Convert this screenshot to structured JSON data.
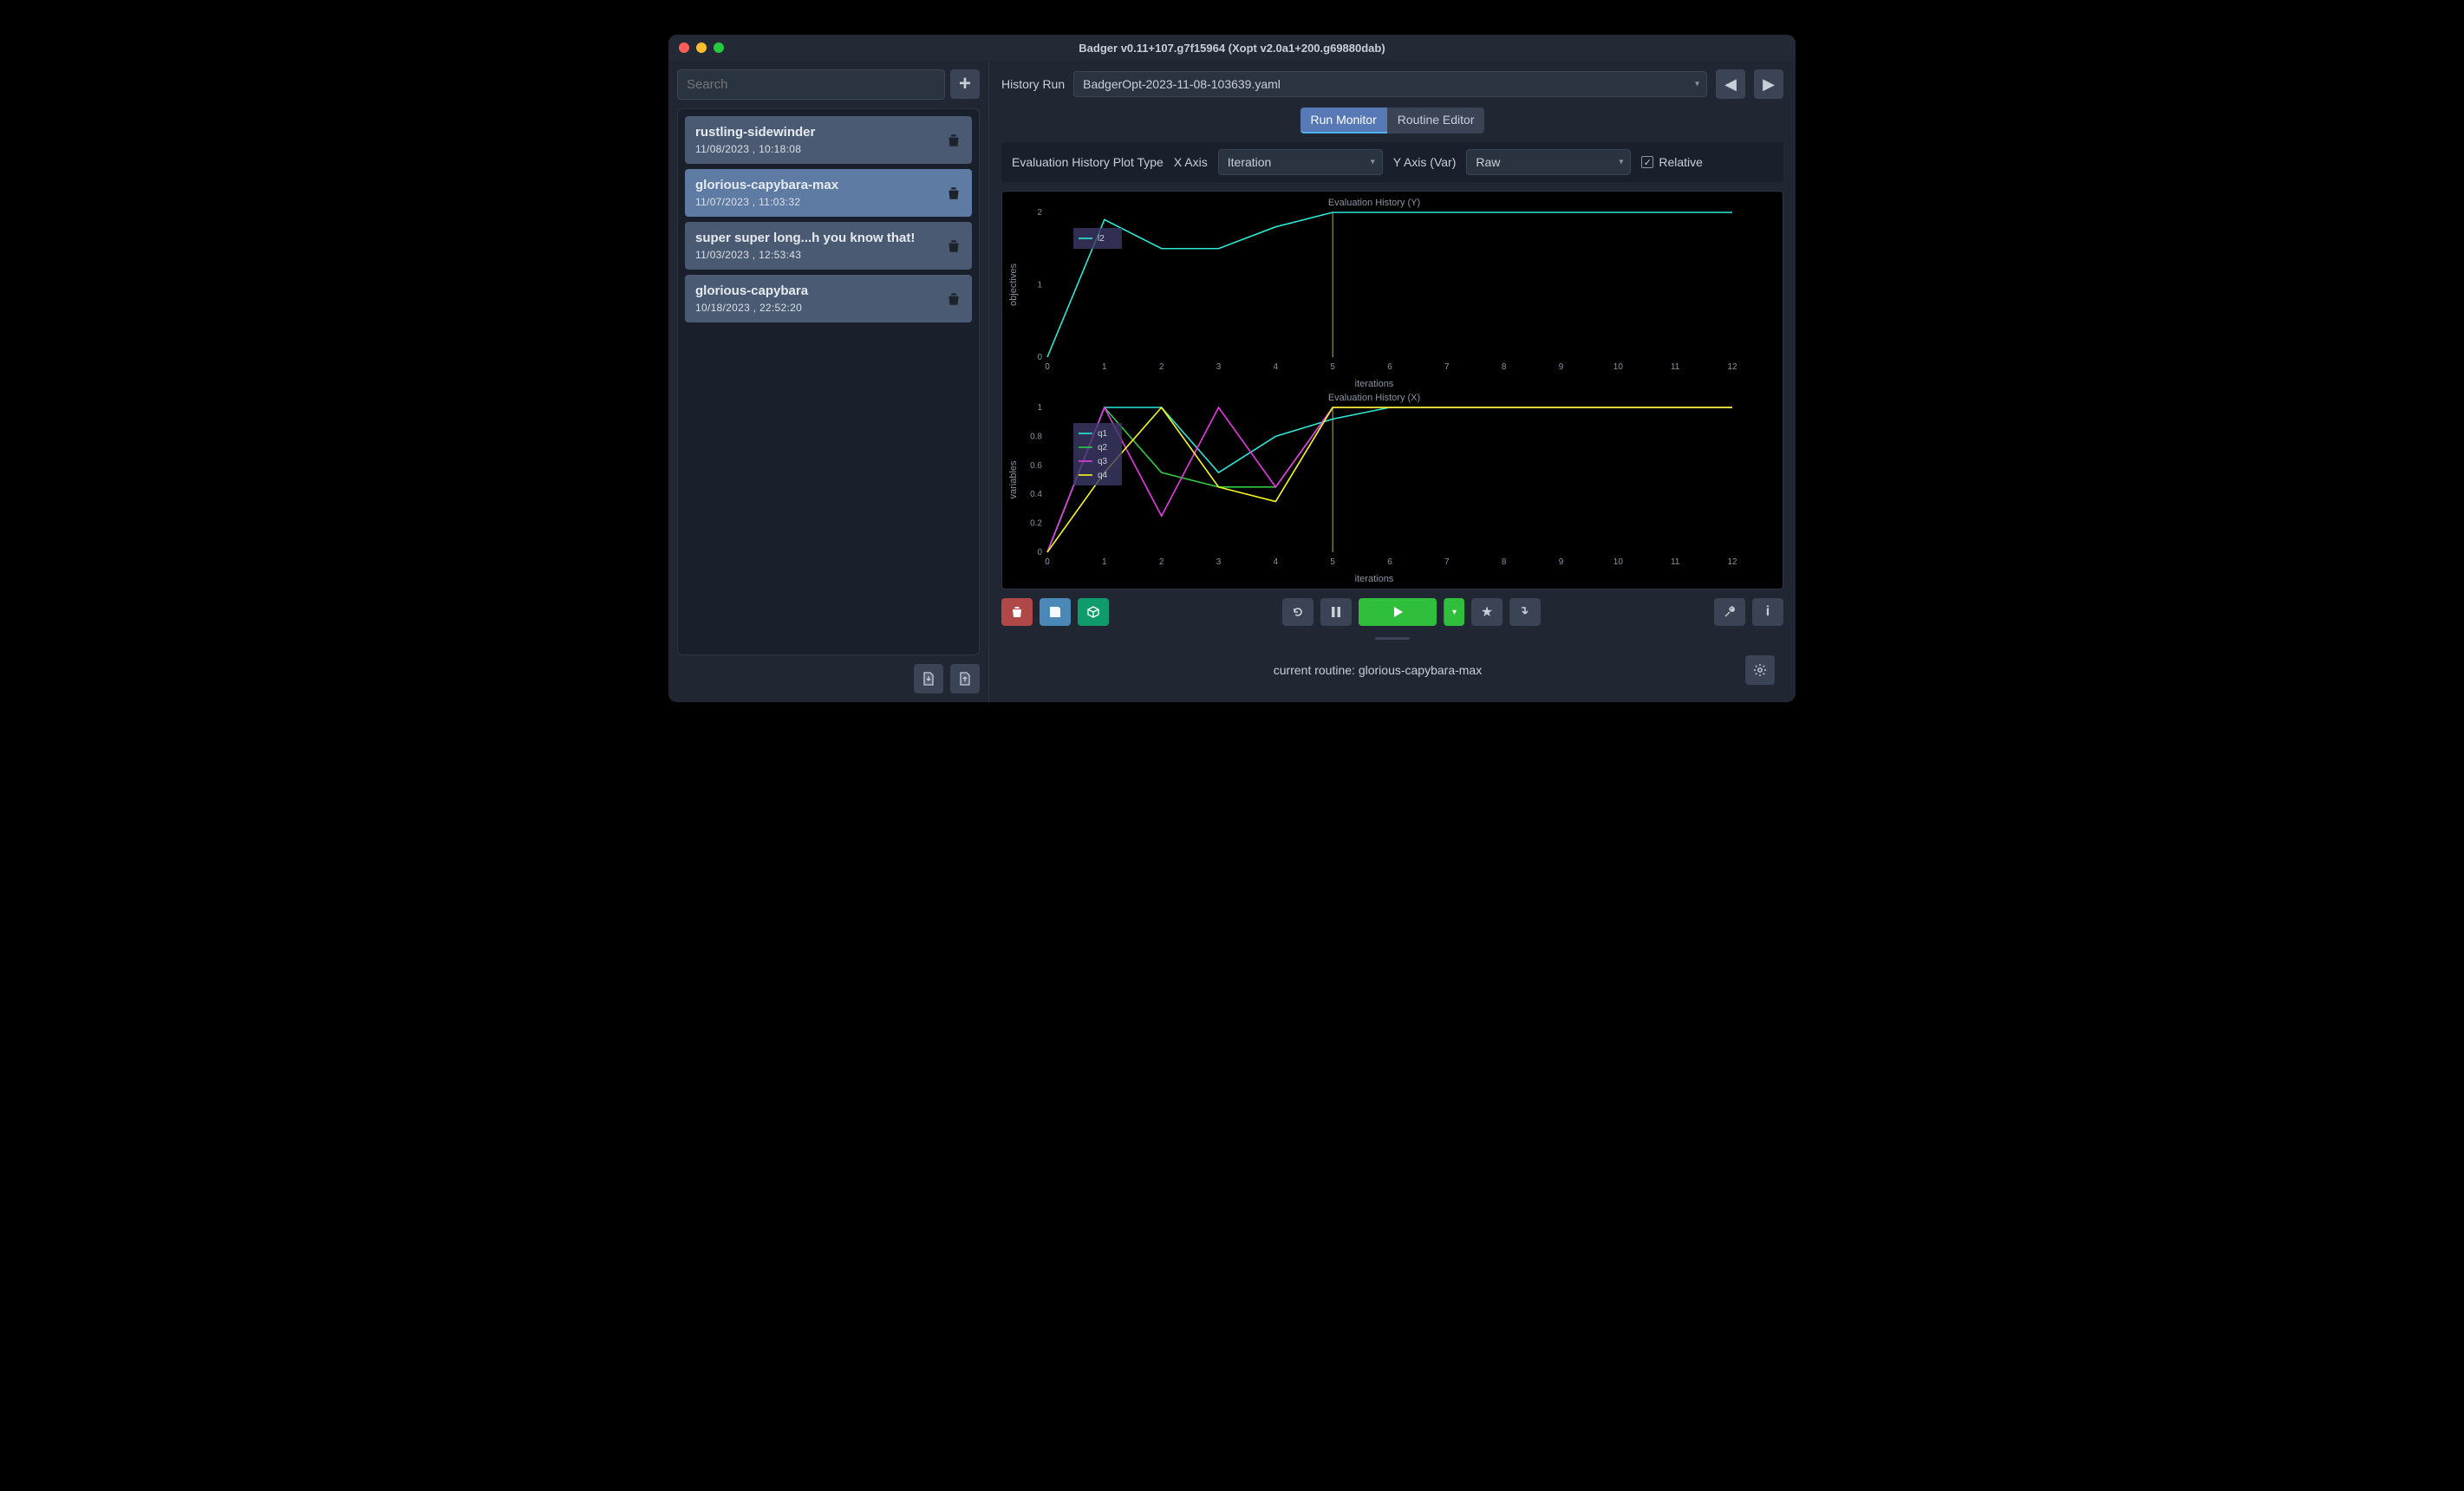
{
  "window_title": "Badger v0.11+107.g7f15964 (Xopt v2.0a1+200.g69880dab)",
  "search": {
    "placeholder": "Search"
  },
  "routines": [
    {
      "name": "rustling-sidewinder",
      "ts": "11/08/2023 , 10:18:08",
      "active": false
    },
    {
      "name": "glorious-capybara-max",
      "ts": "11/07/2023 , 11:03:32",
      "active": true
    },
    {
      "name": "super super long...h you know that!",
      "ts": "11/03/2023 , 12:53:43",
      "active": false
    },
    {
      "name": "glorious-capybara",
      "ts": "10/18/2023 , 22:52:20",
      "active": false
    }
  ],
  "history_run": {
    "label": "History Run",
    "value": "BadgerOpt-2023-11-08-103639.yaml"
  },
  "tabs": {
    "monitor": "Run Monitor",
    "editor": "Routine Editor",
    "active": "monitor"
  },
  "plot_controls": {
    "type_label": "Evaluation History Plot Type",
    "xaxis_label": "X Axis",
    "xaxis_value": "Iteration",
    "yaxis_label": "Y Axis (Var)",
    "yaxis_value": "Raw",
    "relative_label": "Relative",
    "relative_checked": true
  },
  "status": {
    "current_routine_label": "current routine: ",
    "current_routine_value": "glorious-capybara-max"
  },
  "chart_data": [
    {
      "type": "line",
      "title": "Evaluation History (Y)",
      "xlabel": "iterations",
      "ylabel": "objectives",
      "x_ticks": [
        0,
        1,
        2,
        3,
        4,
        5,
        6,
        7,
        8,
        9,
        10,
        11,
        12
      ],
      "y_ticks": [
        0,
        1,
        2
      ],
      "xlim": [
        0,
        12
      ],
      "ylim": [
        0,
        2
      ],
      "cursor_x": 5,
      "legend_position": "upper-left",
      "series": [
        {
          "name": "l2",
          "color": "#2ce8d6",
          "x": [
            0,
            1,
            2,
            3,
            4,
            5,
            6,
            7,
            8,
            9,
            10,
            11,
            12
          ],
          "values": [
            0.0,
            1.9,
            1.5,
            1.5,
            1.8,
            2.0,
            2.0,
            2.0,
            2.0,
            2.0,
            2.0,
            2.0,
            2.0
          ]
        }
      ]
    },
    {
      "type": "line",
      "title": "Evaluation History (X)",
      "xlabel": "iterations",
      "ylabel": "variables",
      "x_ticks": [
        0,
        1,
        2,
        3,
        4,
        5,
        6,
        7,
        8,
        9,
        10,
        11,
        12
      ],
      "y_ticks": [
        0,
        0.2,
        0.4,
        0.6,
        0.8,
        1
      ],
      "xlim": [
        0,
        12
      ],
      "ylim": [
        0,
        1
      ],
      "cursor_x": 5,
      "legend_position": "upper-left",
      "series": [
        {
          "name": "q1",
          "color": "#2ce8d6",
          "x": [
            0,
            1,
            2,
            3,
            4,
            5,
            6,
            7,
            8,
            9,
            10,
            11,
            12
          ],
          "values": [
            0.0,
            1.0,
            1.0,
            0.55,
            0.8,
            0.92,
            1.0,
            1.0,
            1.0,
            1.0,
            1.0,
            1.0,
            1.0
          ]
        },
        {
          "name": "q2",
          "color": "#2ecc40",
          "x": [
            0,
            1,
            2,
            3,
            4,
            5,
            6,
            7,
            8,
            9,
            10,
            11,
            12
          ],
          "values": [
            0.0,
            1.0,
            0.55,
            0.45,
            0.45,
            1.0,
            1.0,
            1.0,
            1.0,
            1.0,
            1.0,
            1.0,
            1.0
          ]
        },
        {
          "name": "q3",
          "color": "#e838e8",
          "x": [
            0,
            1,
            2,
            3,
            4,
            5,
            6,
            7,
            8,
            9,
            10,
            11,
            12
          ],
          "values": [
            0.0,
            1.0,
            0.25,
            1.0,
            0.45,
            1.0,
            1.0,
            1.0,
            1.0,
            1.0,
            1.0,
            1.0,
            1.0
          ]
        },
        {
          "name": "q4",
          "color": "#f8f81e",
          "x": [
            0,
            1,
            2,
            3,
            4,
            5,
            6,
            7,
            8,
            9,
            10,
            11,
            12
          ],
          "values": [
            0.0,
            0.55,
            1.0,
            0.45,
            0.35,
            1.0,
            1.0,
            1.0,
            1.0,
            1.0,
            1.0,
            1.0,
            1.0
          ]
        }
      ]
    }
  ]
}
